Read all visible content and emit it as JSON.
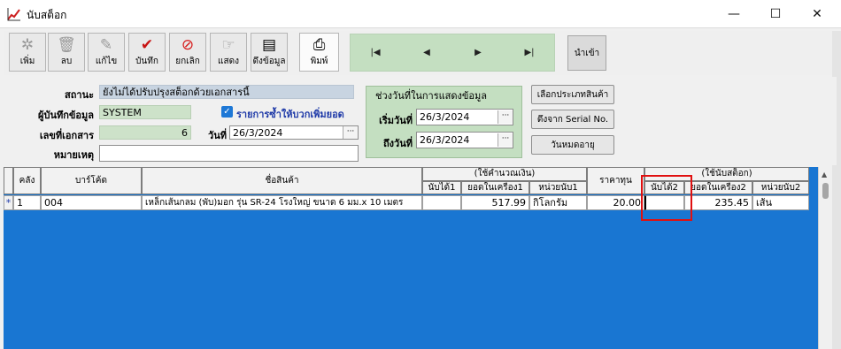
{
  "window": {
    "title": "นับสต็อก",
    "minimize": "—",
    "maximize": "☐",
    "close": "✕"
  },
  "toolbar": {
    "buttons": [
      {
        "label": "เพิ่ม",
        "icon": "add-icon",
        "glyph": "✲"
      },
      {
        "label": "ลบ",
        "icon": "trash-icon",
        "glyph": "🗑"
      },
      {
        "label": "แก้ไข",
        "icon": "edit-icon",
        "glyph": "✎"
      },
      {
        "label": "บันทึก",
        "icon": "check-icon",
        "glyph": "✔"
      },
      {
        "label": "ยกเลิก",
        "icon": "cancel-icon",
        "glyph": "⊘"
      },
      {
        "label": "แสดง",
        "icon": "show-icon",
        "glyph": "☞"
      },
      {
        "label": "ดึงข้อมูล",
        "icon": "fetch-icon",
        "glyph": "▤"
      }
    ],
    "print_label": "พิมพ์",
    "nav": {
      "first": "|◀",
      "prev": "◀",
      "next": "▶",
      "last": "▶|"
    },
    "import_label": "นำเข้า"
  },
  "form": {
    "status_label": "สถานะ",
    "status_value": "ยังไม่ได้ปรับปรุงสต็อกด้วยเอกสารนี้",
    "recorder_label": "ผู้บันทึกข้อมูล",
    "recorder_value": "SYSTEM",
    "add_items_label": "รายการซ้ำให้บวกเพิ่มยอด",
    "docno_label": "เลขที่เอกสาร",
    "docno_value": "6",
    "date_label": "วันที่",
    "date_value": "26/3/2024",
    "note_label": "หมายเหตุ",
    "note_value": "",
    "period": {
      "title": "ช่วงวันที่ในการแสดงข้อมูล",
      "start_label": "เริ่มวันที่",
      "start_value": "26/3/2024",
      "end_label": "ถึงวันที่",
      "end_value": "26/3/2024"
    },
    "select_category_label": "เลือกประเภทสินค้า",
    "serial_label": "ดึงจาก Serial No.",
    "expiry_label": "วันหมดอายุ",
    "dots": "···"
  },
  "grid": {
    "headers": {
      "warehouse": "คลัง",
      "barcode": "บาร์โค้ด",
      "product": "ชื่อสินค้า",
      "group_calc": "(ใช้คำนวณเงิน)",
      "counted1": "นับได้1",
      "machine1": "ยอดในเครื่อง1",
      "unit1": "หน่วยนับ1",
      "cost": "ราคาทุน",
      "group_stock": "(ใช้นับสต็อก)",
      "counted2": "นับได้2",
      "machine2": "ยอดในเครื่อง2",
      "unit2": "หน่วยนับ2"
    },
    "rows": [
      {
        "marker": "*",
        "warehouse": "1",
        "barcode": "004",
        "product": "เหล็กเส้นกลม (พับ)มอก รุ่น SR-24 โรงใหญ่ ขนาด 6 มม.x 10 เมตร",
        "counted1": "",
        "machine1": "517.99",
        "unit1": "กิโลกรัม",
        "cost": "20.00",
        "counted2": "",
        "machine2": "235.45",
        "unit2": "เส้น"
      }
    ]
  },
  "colors": {
    "grid_bg": "#1976d2",
    "panel_green": "#c4dfc1",
    "highlight": "#e01010"
  }
}
